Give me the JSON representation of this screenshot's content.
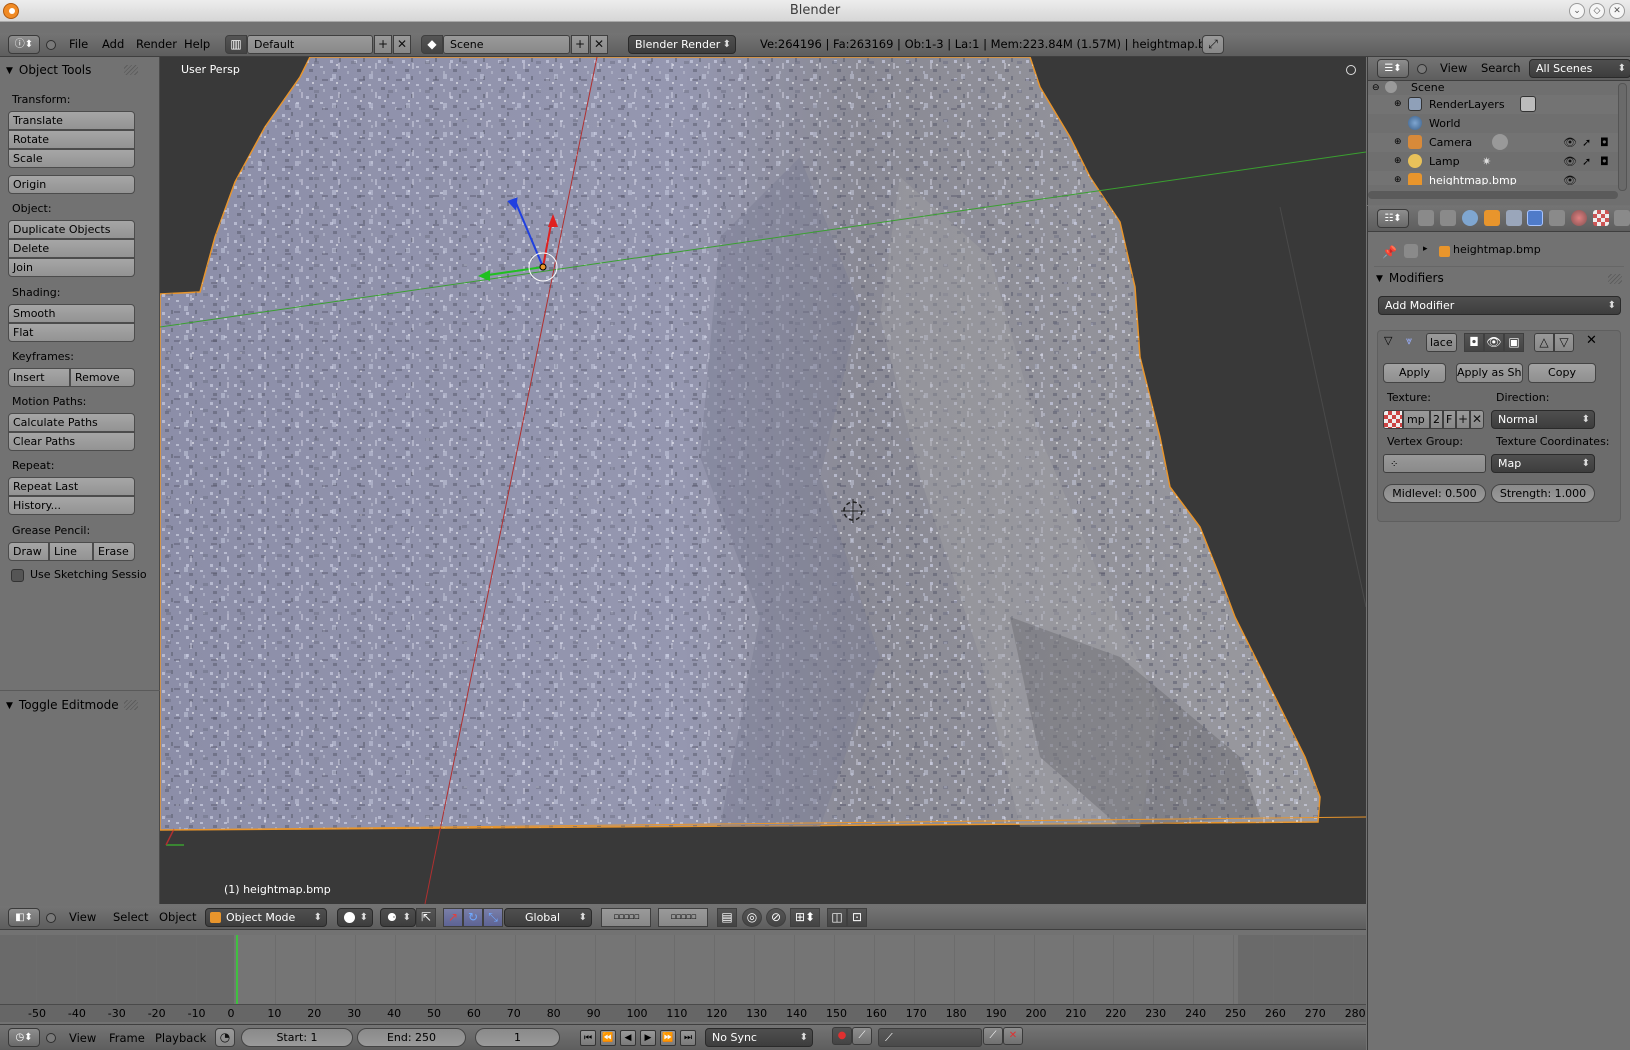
{
  "title_bar": {
    "title": "Blender"
  },
  "info_header": {
    "menus": [
      "File",
      "Add",
      "Render",
      "Help"
    ],
    "screen_layout": "Default",
    "scene": "Scene",
    "render_engine": "Blender Render",
    "stats": "Ve:264196 | Fa:263169 | Ob:1-3 | La:1 | Mem:223.84M (1.57M) | heightmap.bmp"
  },
  "tool_shelf": {
    "panel_title": "Object Tools",
    "transform_label": "Transform:",
    "translate": "Translate",
    "rotate": "Rotate",
    "scale": "Scale",
    "origin": "Origin",
    "object_label": "Object:",
    "duplicate": "Duplicate Objects",
    "delete": "Delete",
    "join": "Join",
    "shading_label": "Shading:",
    "smooth": "Smooth",
    "flat": "Flat",
    "keyframes_label": "Keyframes:",
    "insert": "Insert",
    "remove": "Remove",
    "motion_paths_label": "Motion Paths:",
    "calc_paths": "Calculate Paths",
    "clear_paths": "Clear Paths",
    "repeat_label": "Repeat:",
    "repeat_last": "Repeat Last",
    "history": "History...",
    "grease_label": "Grease Pencil:",
    "draw": "Draw",
    "line": "Line",
    "erase": "Erase",
    "sketching": "Use Sketching Sessio",
    "toggle_editmode": "Toggle Editmode"
  },
  "viewport": {
    "view_label": "User Persp",
    "object_label": "(1) heightmap.bmp"
  },
  "view3d_header": {
    "menus": [
      "View",
      "Select",
      "Object"
    ],
    "mode": "Object Mode",
    "orientation": "Global"
  },
  "outliner": {
    "menus": [
      "View",
      "Search"
    ],
    "filter": "All Scenes",
    "items": [
      "Scene",
      "RenderLayers",
      "World",
      "Camera",
      "Lamp",
      "heightmap.bmp"
    ]
  },
  "properties": {
    "object_name": "heightmap.bmp",
    "panel_title": "Modifiers",
    "add_modifier": "Add Modifier",
    "modifier_name": "lace",
    "apply": "Apply",
    "apply_shape": "Apply as Sha",
    "copy": "Copy",
    "texture_label": "Texture:",
    "texture_name": "mp",
    "texture_users": "2",
    "texture_fake": "F",
    "direction_label": "Direction:",
    "direction": "Normal",
    "vertex_group_label": "Vertex Group:",
    "tex_coords_label": "Texture Coordinates:",
    "tex_coords": "Map",
    "midlevel": "Midlevel: 0.500",
    "strength": "Strength: 1.000"
  },
  "timeline": {
    "ticks": [
      "-50",
      "-40",
      "-30",
      "-20",
      "-10",
      "0",
      "10",
      "20",
      "30",
      "40",
      "50",
      "60",
      "70",
      "80",
      "90",
      "100",
      "110",
      "120",
      "130",
      "140",
      "150",
      "160",
      "170",
      "180",
      "190",
      "200",
      "210",
      "220",
      "230",
      "240",
      "250",
      "260",
      "270",
      "280"
    ],
    "current_frame_value": 0
  },
  "timeline_header": {
    "menus": [
      "View",
      "Frame",
      "Playback"
    ],
    "start": "Start: 1",
    "end": "End: 250",
    "current": "1",
    "sync": "No Sync"
  },
  "colors": {
    "selection_outline": "#e8952c",
    "x_axis": "#b03030",
    "y_axis": "#3aa030",
    "frame_cursor": "#40c040"
  }
}
